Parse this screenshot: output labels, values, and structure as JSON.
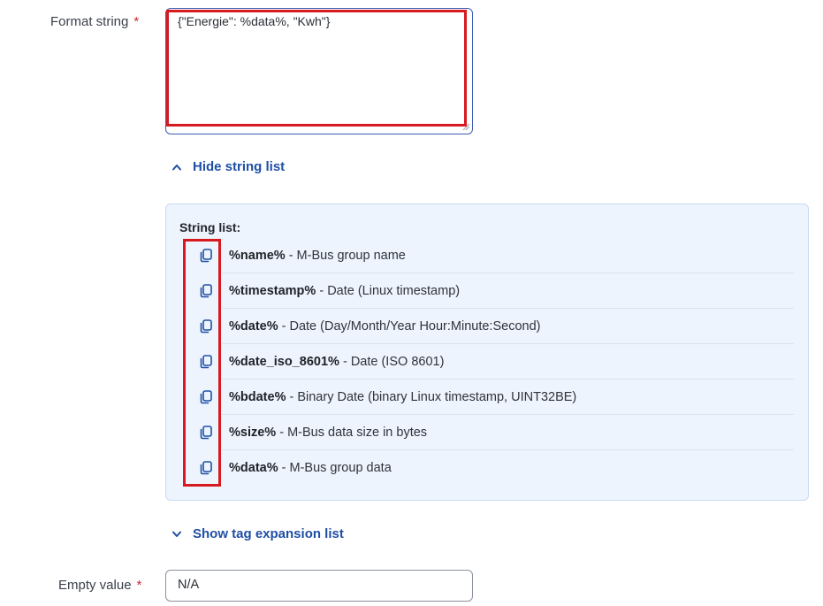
{
  "format_string": {
    "label": "Format string",
    "required_mark": "*",
    "value": "{\"Energie\": %data%, \"Kwh\"}"
  },
  "hide_string_list": {
    "label": "Hide string list",
    "icon": "chevron-up-icon"
  },
  "string_list": {
    "title": "String list:",
    "copy_icon": "copy-icon",
    "items": [
      {
        "tag": "%name%",
        "desc": " - M-Bus group name"
      },
      {
        "tag": "%timestamp%",
        "desc": " - Date (Linux timestamp)"
      },
      {
        "tag": "%date%",
        "desc": " - Date (Day/Month/Year Hour:Minute:Second)"
      },
      {
        "tag": "%date_iso_8601%",
        "desc": " - Date (ISO 8601)"
      },
      {
        "tag": "%bdate%",
        "desc": " - Binary Date (binary Linux timestamp, UINT32BE)"
      },
      {
        "tag": "%size%",
        "desc": " - M-Bus data size in bytes"
      },
      {
        "tag": "%data%",
        "desc": " - M-Bus group data"
      }
    ]
  },
  "show_tag_expansion": {
    "label": "Show tag expansion list",
    "icon": "chevron-down-icon"
  },
  "empty_value": {
    "label": "Empty value",
    "required_mark": "*",
    "value": "N/A"
  },
  "colors": {
    "link": "#1f4fa5",
    "highlight": "#d81920",
    "panel_bg": "#edf4fd",
    "required": "#d12b2b"
  }
}
